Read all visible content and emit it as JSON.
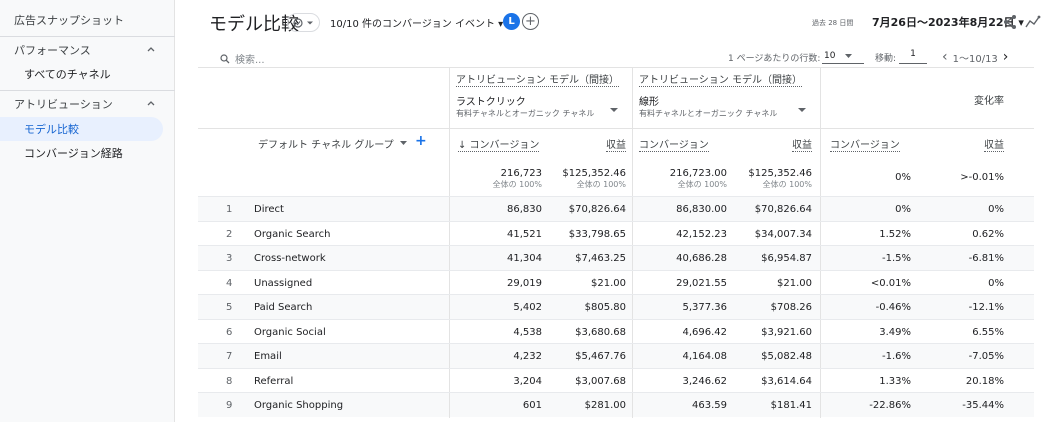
{
  "sidebar": {
    "title": "広告スナップショット",
    "sections": [
      {
        "label": "パフォーマンス",
        "items": [
          "すべてのチャネル"
        ]
      },
      {
        "label": "アトリビューション",
        "items": [
          "モデル比較",
          "コンバージョン経路"
        ]
      }
    ],
    "active_item": "モデル比較"
  },
  "header": {
    "title": "モデル比較",
    "conversion_events": "10/10 件のコンバージョン イベント ▾",
    "avatar_letter": "L",
    "date_prefix": "過去 28 日間",
    "date_range": "7月26日～2023年8月22日 ▾"
  },
  "toolbar": {
    "search_placeholder": "検索...",
    "rows_per_page_label": "1 ページあたりの行数:",
    "rows_per_page_value": "10",
    "goto_label": "移動:",
    "goto_value": "1",
    "pagination": "1～10/13"
  },
  "models": [
    {
      "title": "アトリビューション モデル（間接）",
      "name": "ラストクリック",
      "sub": "有料チャネルとオーガニック チャネル"
    },
    {
      "title": "アトリビューション モデル（間接）",
      "name": "線形",
      "sub": "有料チャネルとオーガニック チャネル"
    }
  ],
  "change_label": "変化率",
  "dimension_label": "デフォルト チャネル グループ",
  "metric_labels": {
    "m1_conv": "↓ コンバージョン",
    "m1_rev": "収益",
    "m2_conv": "コンバージョン",
    "m2_rev": "収益",
    "ch_conv": "コンバージョン",
    "ch_rev": "収益"
  },
  "totals": {
    "m1_conv": "216,723",
    "m1_rev": "$125,352.46",
    "m2_conv": "216,723.00",
    "m2_rev": "$125,352.46",
    "ch_conv": "0%",
    "ch_rev": ">-0.01%",
    "pct_label": "全体の 100%"
  },
  "rows": [
    {
      "i": "1",
      "name": "Direct",
      "m1c": "86,830",
      "m1r": "$70,826.64",
      "m2c": "86,830.00",
      "m2r": "$70,826.64",
      "chc": "0%",
      "chr": "0%"
    },
    {
      "i": "2",
      "name": "Organic Search",
      "m1c": "41,521",
      "m1r": "$33,798.65",
      "m2c": "42,152.23",
      "m2r": "$34,007.34",
      "chc": "1.52%",
      "chr": "0.62%"
    },
    {
      "i": "3",
      "name": "Cross-network",
      "m1c": "41,304",
      "m1r": "$7,463.25",
      "m2c": "40,686.28",
      "m2r": "$6,954.87",
      "chc": "-1.5%",
      "chr": "-6.81%"
    },
    {
      "i": "4",
      "name": "Unassigned",
      "m1c": "29,019",
      "m1r": "$21.00",
      "m2c": "29,021.55",
      "m2r": "$21.00",
      "chc": "<0.01%",
      "chr": "0%"
    },
    {
      "i": "5",
      "name": "Paid Search",
      "m1c": "5,402",
      "m1r": "$805.80",
      "m2c": "5,377.36",
      "m2r": "$708.26",
      "chc": "-0.46%",
      "chr": "-12.1%"
    },
    {
      "i": "6",
      "name": "Organic Social",
      "m1c": "4,538",
      "m1r": "$3,680.68",
      "m2c": "4,696.42",
      "m2r": "$3,921.60",
      "chc": "3.49%",
      "chr": "6.55%"
    },
    {
      "i": "7",
      "name": "Email",
      "m1c": "4,232",
      "m1r": "$5,467.76",
      "m2c": "4,164.08",
      "m2r": "$5,082.48",
      "chc": "-1.6%",
      "chr": "-7.05%"
    },
    {
      "i": "8",
      "name": "Referral",
      "m1c": "3,204",
      "m1r": "$3,007.68",
      "m2c": "3,246.62",
      "m2r": "$3,614.64",
      "chc": "1.33%",
      "chr": "20.18%"
    },
    {
      "i": "9",
      "name": "Organic Shopping",
      "m1c": "601",
      "m1r": "$281.00",
      "m2c": "463.59",
      "m2r": "$181.41",
      "chc": "-22.86%",
      "chr": "-35.44%"
    }
  ],
  "colors": {
    "accent": "#1a73e8",
    "active_bg": "#e8f0fe",
    "sidebar_bg": "#f8f9fa"
  }
}
